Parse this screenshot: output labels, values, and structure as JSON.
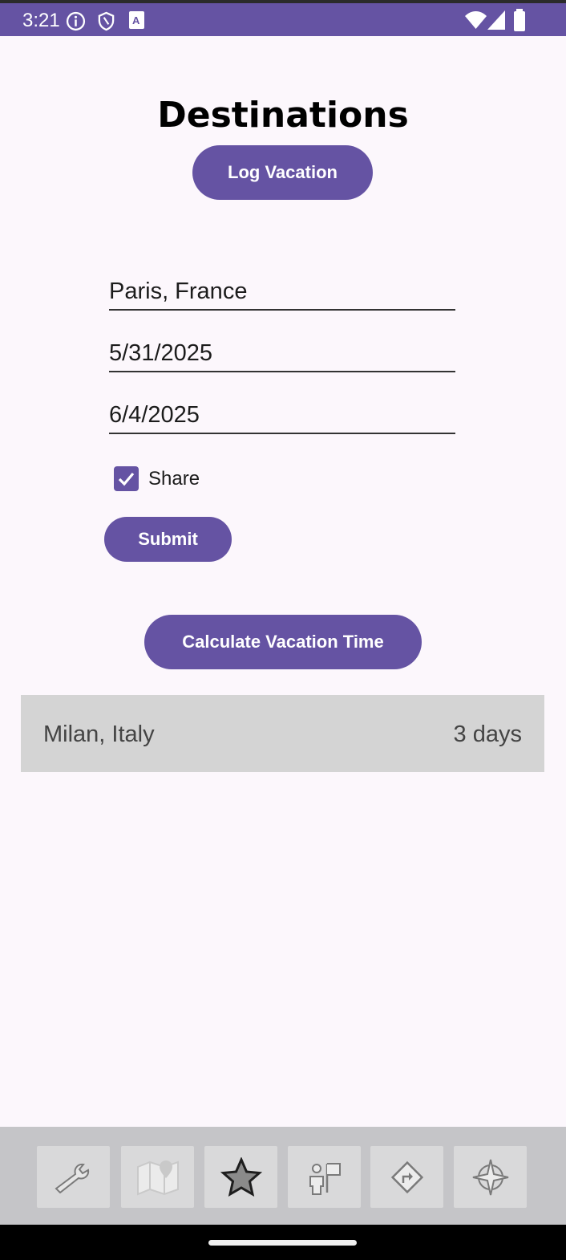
{
  "status_bar": {
    "time": "3:21",
    "left_icons": [
      "info-icon",
      "shield-icon",
      "text-a-icon"
    ],
    "right_icons": [
      "wifi-icon",
      "signal-icon",
      "battery-icon"
    ],
    "color": "#6553a3"
  },
  "header": {
    "title": "Destinations",
    "log_vacation_label": "Log Vacation"
  },
  "form": {
    "destination_value": "Paris, France",
    "start_date_value": "5/31/2025",
    "end_date_value": "6/4/2025",
    "share_label": "Share",
    "share_checked": true,
    "submit_label": "Submit"
  },
  "calculate_label": "Calculate Vacation Time",
  "vacations": [
    {
      "destination": "Milan, Italy",
      "duration": "3 days"
    }
  ],
  "bottom_nav": {
    "items": [
      "wrench-icon",
      "map-pin-icon",
      "star-icon",
      "person-flag-icon",
      "directions-sign-icon",
      "compass-icon"
    ],
    "selected": "star-icon"
  },
  "colors": {
    "accent": "#6553a3",
    "background": "#fcf7fc",
    "list_item": "#d4d4d4"
  }
}
